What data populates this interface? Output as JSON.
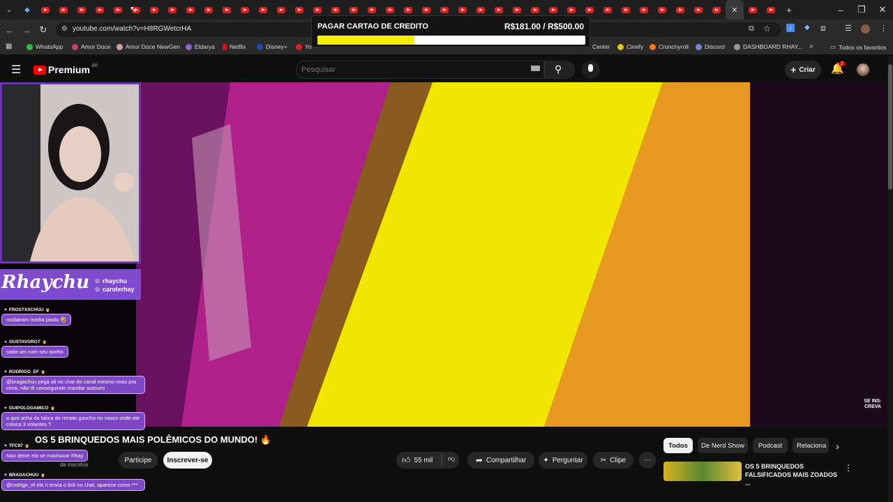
{
  "browser": {
    "url": "youtube.com/watch?v=H8RGWetcrHA",
    "bookmarks": [
      "WhatsApp",
      "Amor Doce",
      "Amor Doce NewGen",
      "Eldarya",
      "Netflix",
      "Disney+",
      "Yo",
      "Center",
      "Cinefy",
      "Crunchyroll",
      "Discord",
      "DASHBOARD RHAY...",
      "Todos os favoritos"
    ]
  },
  "overlay": {
    "title": "PAGAR CARTAO DE CREDITO",
    "amount": "R$181.00 / R$500.00",
    "progress": 0.362
  },
  "youtube": {
    "brand": "Premium",
    "region": "BR",
    "search_placeholder": "Pesquisar",
    "create_label": "Criar",
    "notif_count": "2"
  },
  "stream": {
    "logo_text": "Rhaychu",
    "socials": [
      "rhaychu",
      "carolerhay"
    ],
    "subscribe_watermark": "SE INS- CREVA"
  },
  "chat": [
    {
      "user": "FROSTXXCHUU",
      "message": "roubaram minha piada 🤣"
    },
    {
      "user": "GUSTAVORGT",
      "message": "cada um com seu sonho"
    },
    {
      "user": "RODRIGO_EF",
      "message": "@bragachuu pega ali no chat do canal mesmo mais pra cima, não tô conseguindo mandar sussuro"
    },
    {
      "user": "GUIPOLOGAMICO",
      "message": "o que acha da tatica do renato gaucho no vasco onde ele coloca 3 volantes ?"
    },
    {
      "user": "TFC97",
      "message": "Nao deixe ela se machucar Rhay"
    },
    {
      "user": "BRAGACHUU",
      "message": "@rodrigo_ef ele n envia o link no chat, aparece como ***"
    }
  ],
  "video": {
    "title": "OS 5 BRINQUEDOS MAIS POLÊMICOS DO MUNDO! 🔥",
    "join_label": "Participe",
    "subscribe_label": "Inscrever-se",
    "subs_fragment": "de inscritos",
    "likes": "55 mil",
    "share_label": "Compartilhar",
    "ask_label": "Perguntar",
    "clip_label": "Clipe"
  },
  "chips": [
    "Todos",
    "De Nerd Show",
    "Podcast",
    "Relaciona"
  ],
  "recommended": {
    "title": "OS 5 BRINQUEDOS FALSIFICADOS MAIS ZOADOS ..."
  },
  "colors": {
    "accent_purple": "#7d47c5",
    "yt_red": "#ff0000",
    "overlay_yellow": "#f6ee00"
  }
}
